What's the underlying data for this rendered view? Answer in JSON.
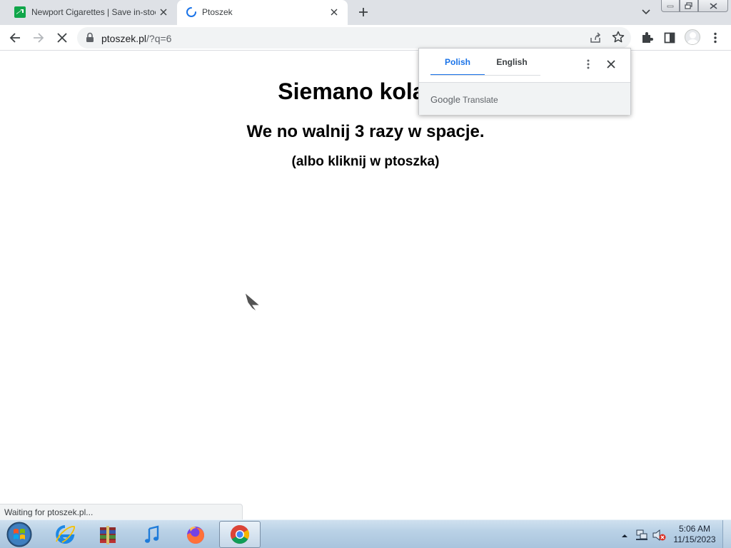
{
  "browser": {
    "tabs": [
      {
        "title": "Newport Cigarettes | Save in-stock",
        "active": false,
        "favicon": "newport-favicon"
      },
      {
        "title": "Ptoszek",
        "active": true,
        "favicon": "loading-spinner"
      }
    ],
    "window_buttons": [
      "minimize",
      "restore",
      "close"
    ]
  },
  "toolbar": {
    "url_host": "ptoszek.pl",
    "url_path": "/?q=6",
    "icons": [
      "back-icon",
      "forward-icon",
      "stop-icon",
      "lock-icon",
      "share-icon",
      "star-icon",
      "extensions-icon",
      "side-panel-icon",
      "profile-avatar",
      "menu-icon"
    ]
  },
  "page": {
    "heading": "Siemano kolano",
    "subheading": "We no walnij 3 razy w spacje.",
    "hint": "(albo kliknij w ptoszka)"
  },
  "translate_bubble": {
    "source_language": "Polish",
    "target_language": "English",
    "brand_google": "Google",
    "brand_translate": "Translate",
    "accent_color": "#1a73e8"
  },
  "status_bar": {
    "text": "Waiting for ptoszek.pl..."
  },
  "taskbar": {
    "apps": [
      "start-orb",
      "internet-explorer",
      "winrar",
      "itunes",
      "firefox",
      "chrome"
    ],
    "clock_time": "5:06 AM",
    "clock_date": "11/15/2023"
  }
}
